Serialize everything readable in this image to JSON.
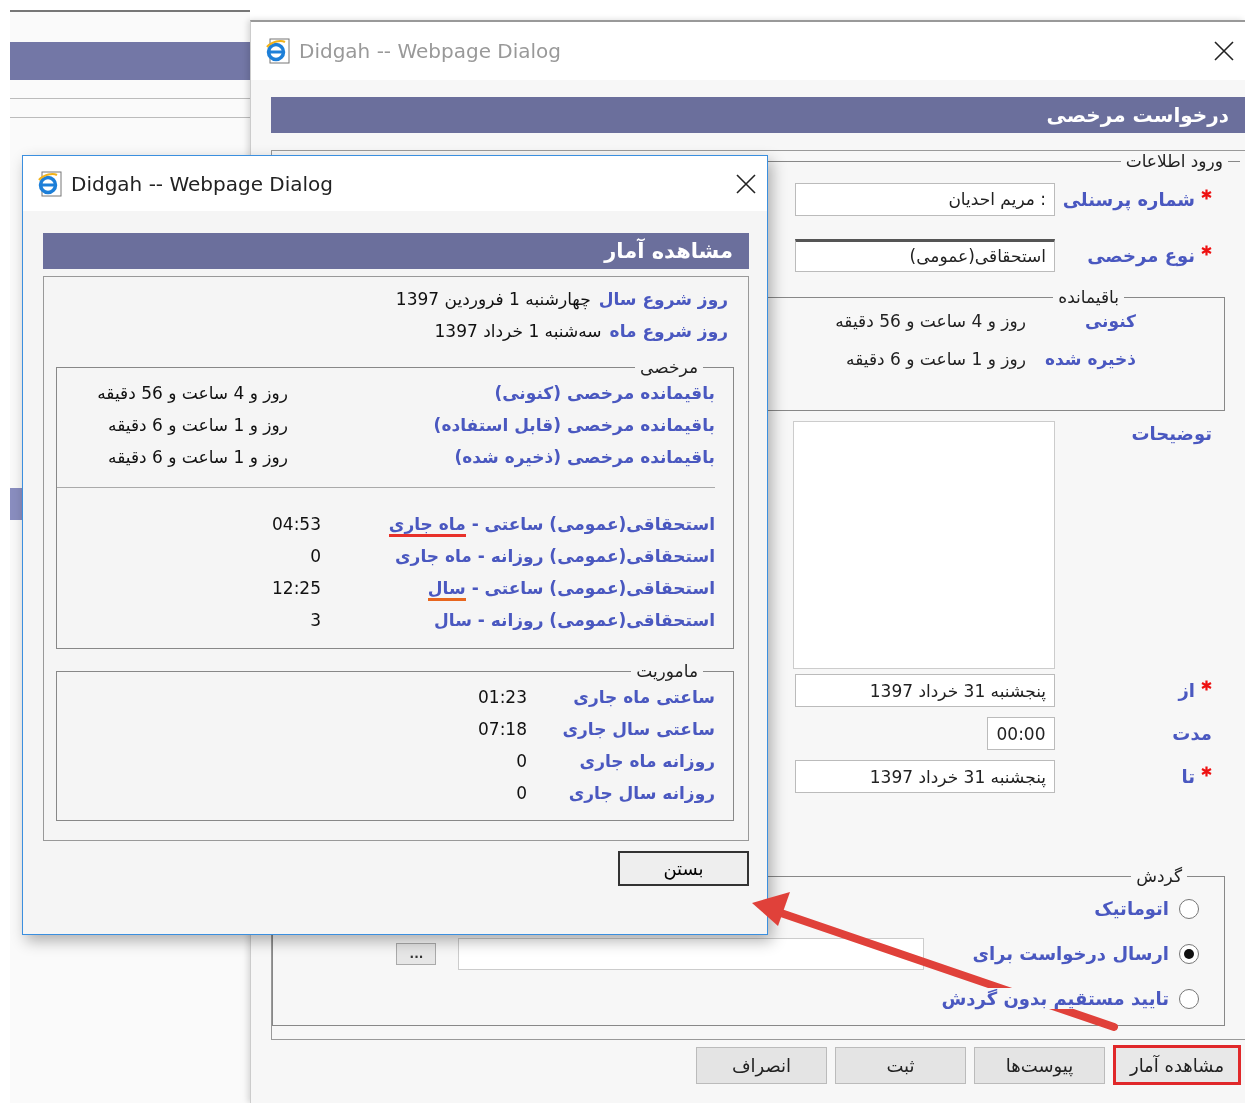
{
  "request_dialog": {
    "title": "Didgah -- Webpage Dialog",
    "header": "درخواست مرخصی",
    "info_legend": "ورود اطلاعات",
    "fields": [
      {
        "label": "شماره پرسنلی",
        "required": true,
        "kind": "text",
        "value": ": مریم احدیان"
      },
      {
        "label": "نوع مرخصی",
        "required": true,
        "kind": "select",
        "value": "استحقاقی(عمومی)"
      }
    ],
    "remaining": {
      "legend": "باقیمانده",
      "rows": [
        {
          "label": "کنونی",
          "value": "روز و 4 ساعت و 56 دقیقه"
        },
        {
          "label": "ذخیره شده",
          "value": "روز و 1 ساعت و 6 دقیقه"
        }
      ]
    },
    "notes_label": "توضیحات",
    "period": [
      {
        "label": "از",
        "required": true,
        "kind": "date",
        "value": "پنجشنبه 31 خرداد 1397"
      },
      {
        "label": "مدت",
        "required": false,
        "kind": "time",
        "value": "00:00"
      },
      {
        "label": "تا",
        "required": true,
        "kind": "date",
        "value": "پنجشنبه 31 خرداد 1397"
      }
    ],
    "routing": {
      "legend": "گردش",
      "browse_button": "...",
      "options": [
        {
          "label": "اتوماتیک",
          "selected": false
        },
        {
          "label": "ارسال درخواست برای",
          "selected": true
        },
        {
          "label": "تایید مستقیم بدون گردش",
          "selected": false
        }
      ]
    },
    "buttons": [
      {
        "label": "مشاهده آمار",
        "highlighted": true
      },
      {
        "label": "پیوست‌ها",
        "highlighted": false
      },
      {
        "label": "ثبت",
        "highlighted": false
      },
      {
        "label": "انصراف",
        "highlighted": false
      }
    ]
  },
  "stats_dialog": {
    "title": "Didgah -- Webpage Dialog",
    "header": "مشاهده آمار",
    "start_days": [
      {
        "label": "روز شروع سال",
        "value": "چهارشنبه 1 فروردین 1397"
      },
      {
        "label": "روز شروع ماه",
        "value": "سه‌شنبه 1 خرداد 1397"
      }
    ],
    "leave": {
      "legend": "مرخصی",
      "remaining": [
        {
          "label": "باقیمانده مرخصی (کنونی)",
          "value": "روز و 4 ساعت و 56 دقیقه"
        },
        {
          "label": "باقیمانده مرخصی (قابل استفاده)",
          "value": "روز و 1 ساعت و 6 دقیقه"
        },
        {
          "label": "باقیمانده مرخصی (ذخیره شده)",
          "value": "روز و 1 ساعت و 6 دقیقه"
        }
      ],
      "usage": [
        {
          "label": "استحقاقی(عمومی) ساعتی -",
          "underline": {
            "text": "ماه جاری",
            "color": "#e8312a"
          },
          "value": "04:53"
        },
        {
          "label": "استحقاقی(عمومی) روزانه - ماه جاری",
          "value": "0"
        },
        {
          "label": "استحقاقی(عمومی) ساعتی -",
          "underline": {
            "text": "سال",
            "color": "#e8661e"
          },
          "value": "12:25"
        },
        {
          "label": "استحقاقی(عمومی) روزانه - سال",
          "value": "3"
        }
      ]
    },
    "mission": {
      "legend": "ماموریت",
      "rows": [
        {
          "label": "ساعتی ماه جاری",
          "value": "01:23"
        },
        {
          "label": "ساعتی سال جاری",
          "value": "07:18"
        },
        {
          "label": "روزانه ماه جاری",
          "value": "0"
        },
        {
          "label": "روزانه سال جاری",
          "value": "0"
        }
      ]
    },
    "close_button": "بستن"
  },
  "annotations": [
    {
      "kind": "arrow"
    }
  ]
}
